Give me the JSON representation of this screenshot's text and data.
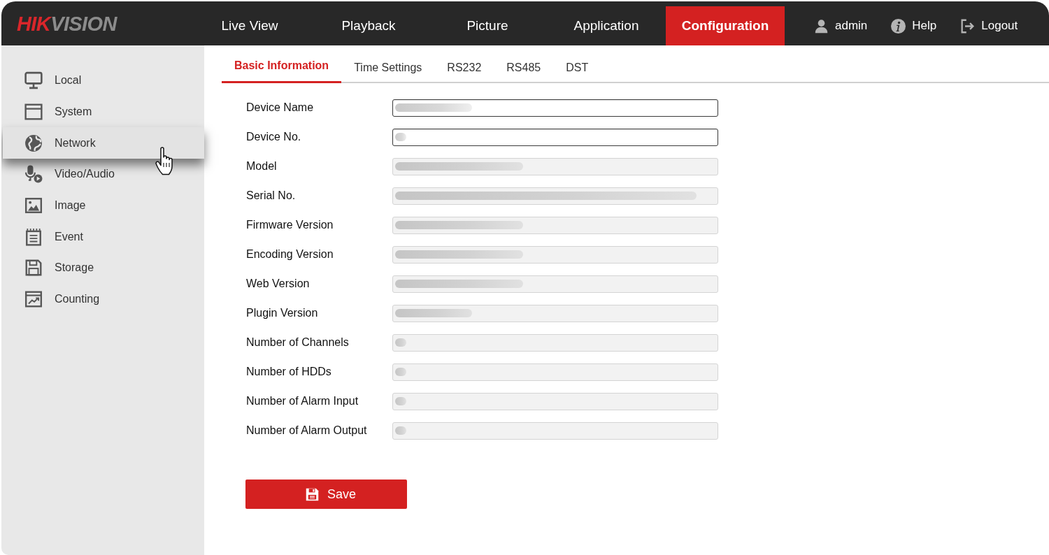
{
  "top_bar": {
    "logo": [
      {
        "text": "HIK",
        "color": "#d9262b"
      },
      {
        "text": "VISION",
        "color": "#8c8c8c"
      }
    ],
    "nav": [
      {
        "label": "Live View",
        "selected": false
      },
      {
        "label": "Playback",
        "selected": false
      },
      {
        "label": "Picture",
        "selected": false
      },
      {
        "label": "Application",
        "selected": false
      },
      {
        "label": "Configuration",
        "selected": true
      }
    ],
    "user_menu": [
      {
        "label": "admin"
      },
      {
        "label": "Help"
      },
      {
        "label": "Logout"
      }
    ]
  },
  "sidebar": {
    "items": [
      {
        "label": "Local",
        "selected": false
      },
      {
        "label": "System",
        "selected": false
      },
      {
        "label": "Network",
        "selected": true
      },
      {
        "label": "Video/Audio",
        "selected": false
      },
      {
        "label": "Image",
        "selected": false
      },
      {
        "label": "Event",
        "selected": false
      },
      {
        "label": "Storage",
        "selected": false
      },
      {
        "label": "Counting",
        "selected": false
      }
    ]
  },
  "tabs": [
    {
      "label": "Basic Information",
      "selected": true
    },
    {
      "label": "Time Settings",
      "selected": false
    },
    {
      "label": "RS232",
      "selected": false
    },
    {
      "label": "RS485",
      "selected": false
    },
    {
      "label": "DST",
      "selected": false
    }
  ],
  "form": {
    "fields": [
      {
        "label": "Device Name",
        "disabled": false,
        "kind": "short"
      },
      {
        "label": "Device No.",
        "disabled": false,
        "kind": "tiny"
      },
      {
        "label": "Model",
        "disabled": true,
        "kind": "medium"
      },
      {
        "label": "Serial No.",
        "disabled": true,
        "kind": "long"
      },
      {
        "label": "Firmware Version",
        "disabled": true,
        "kind": "medium"
      },
      {
        "label": "Encoding Version",
        "disabled": true,
        "kind": "medium"
      },
      {
        "label": "Web Version",
        "disabled": true,
        "kind": "medium"
      },
      {
        "label": "Plugin Version",
        "disabled": true,
        "kind": "short"
      },
      {
        "label": "Number of Channels",
        "disabled": true,
        "kind": "tiny"
      },
      {
        "label": "Number of HDDs",
        "disabled": true,
        "kind": "tiny"
      },
      {
        "label": "Number of Alarm Input",
        "disabled": true,
        "kind": "tiny"
      },
      {
        "label": "Number of Alarm Output",
        "disabled": true,
        "kind": "tiny"
      }
    ]
  },
  "save_button": {
    "label": "Save"
  }
}
